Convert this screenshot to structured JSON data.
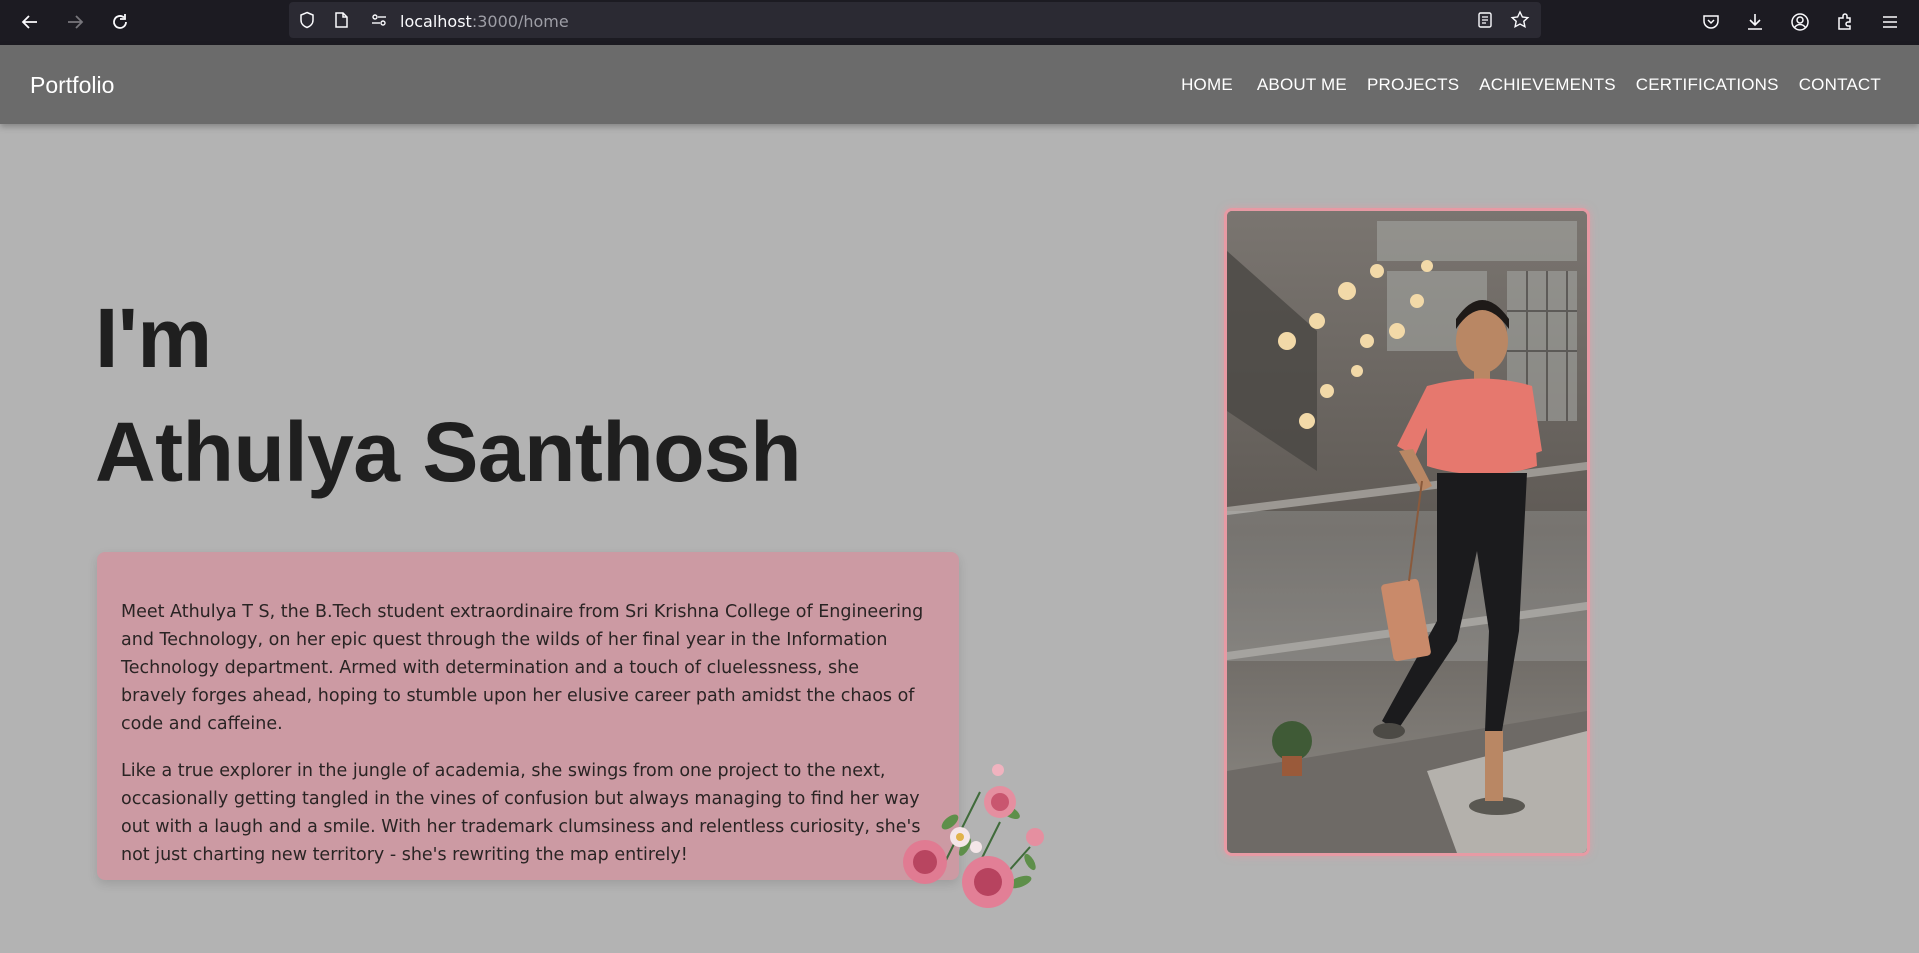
{
  "browser": {
    "url_host": "localhost",
    "url_path": ":3000/home"
  },
  "nav": {
    "brand": "Portfolio",
    "items": [
      "HOME",
      "ABOUT ME",
      "PROJECTS",
      "ACHIEVEMENTS",
      "CERTIFICATIONS",
      "CONTACT"
    ]
  },
  "hero": {
    "line1": "I'm",
    "line2": "Athulya Santhosh"
  },
  "about": {
    "paragraph1": "Meet Athulya T S, the B.Tech student extraordinaire from Sri Krishna College of Engineering and Technology, on her epic quest through the wilds of her final year in the Information Technology department. Armed with determination and a touch of cluelessness, she bravely forges ahead, hoping to stumble upon her elusive career path amidst the chaos of code and caffeine.",
    "paragraph2": "Like a true explorer in the jungle of academia, she swings from one project to the next, occasionally getting tangled in the vines of confusion but always managing to find her way out with a laugh and a smile. With her trademark clumsiness and relentless curiosity, she's not just charting new territory - she's rewriting the map entirely!"
  },
  "colors": {
    "page_bg": "#b3b3b3",
    "navbar_bg": "#6b6b6b",
    "card_bg": "#cc9aa3",
    "photo_border": "#e79aa4"
  }
}
